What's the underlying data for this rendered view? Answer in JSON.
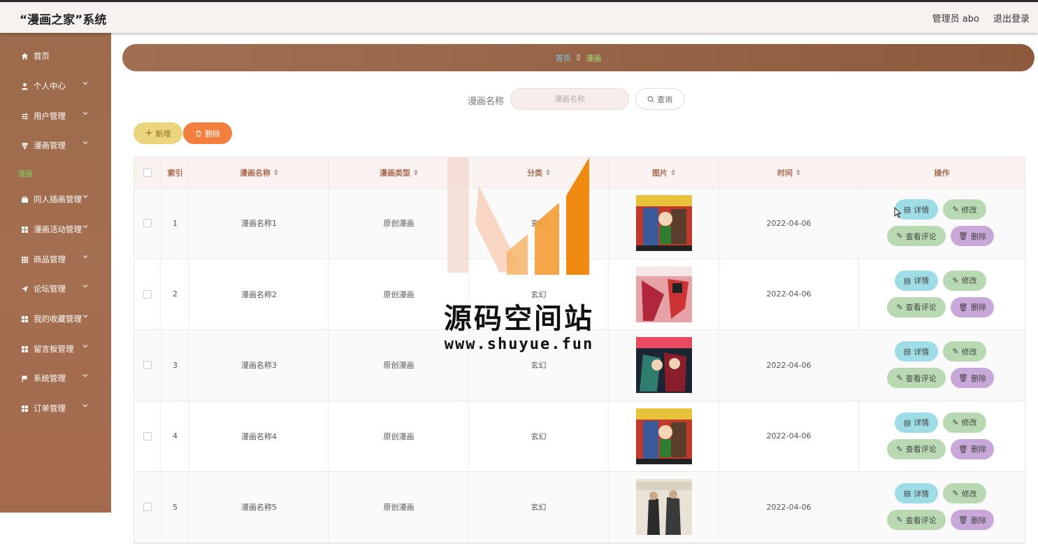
{
  "app": {
    "title": "“漫画之家”系统"
  },
  "header": {
    "user_label": "管理员 abo",
    "logout_label": "退出登录"
  },
  "sidebar": {
    "items": [
      {
        "label": "首页",
        "icon": "home-icon"
      },
      {
        "label": "个人中心",
        "icon": "user-icon"
      },
      {
        "label": "用户管理",
        "icon": "sliders-icon"
      },
      {
        "label": "漫画管理",
        "icon": "cup-icon"
      },
      {
        "label": "同人插画管理",
        "icon": "bag-icon"
      },
      {
        "label": "漫画活动管理",
        "icon": "grid-icon"
      },
      {
        "label": "商品管理",
        "icon": "grid-icon"
      },
      {
        "label": "论坛管理",
        "icon": "send-icon"
      },
      {
        "label": "我的收藏管理",
        "icon": "grid-icon"
      },
      {
        "label": "留言板管理",
        "icon": "grid-icon"
      },
      {
        "label": "系统管理",
        "icon": "flag-icon"
      },
      {
        "label": "订单管理",
        "icon": "grid-icon"
      }
    ],
    "active_sub": "漫画"
  },
  "breadcrumb": {
    "home": "首页",
    "separator": "▯",
    "current": "漫画"
  },
  "search": {
    "label": "漫画名称",
    "placeholder": "漫画名称",
    "button": "查询"
  },
  "actions": {
    "add": "新增",
    "delete": "删除"
  },
  "table": {
    "headers": {
      "index": "索引",
      "name": "漫画名称",
      "type": "漫画类型",
      "category": "分类",
      "image": "图片",
      "time": "时间",
      "ops": "操作"
    },
    "rows": [
      {
        "index": "1",
        "name": "漫画名称1",
        "type": "原创漫画",
        "category": "玄幻",
        "time": "2022-04-06",
        "cover": "detective-cover"
      },
      {
        "index": "2",
        "name": "漫画名称2",
        "type": "原创漫画",
        "category": "玄幻",
        "time": "2022-04-06",
        "cover": "tokyo-cover"
      },
      {
        "index": "3",
        "name": "漫画名称3",
        "type": "原创漫画",
        "category": "玄幻",
        "time": "2022-04-06",
        "cover": "demon-cover"
      },
      {
        "index": "4",
        "name": "漫画名称4",
        "type": "原创漫画",
        "category": "玄幻",
        "time": "2022-04-06",
        "cover": "detective-cover"
      },
      {
        "index": "5",
        "name": "漫画名称5",
        "type": "原创漫画",
        "category": "玄幻",
        "time": "2022-04-06",
        "cover": "yorker-cover"
      }
    ],
    "ops": {
      "detail": "详情",
      "edit": "修改",
      "comments": "查看评论",
      "delete": "删除"
    }
  },
  "watermark": {
    "title": "源码空间站",
    "url": "www.shuyue.fun"
  },
  "colors": {
    "sidebar": "#a06a4d",
    "accent_green": "#7cd35a",
    "header_text": "#a6694e"
  }
}
